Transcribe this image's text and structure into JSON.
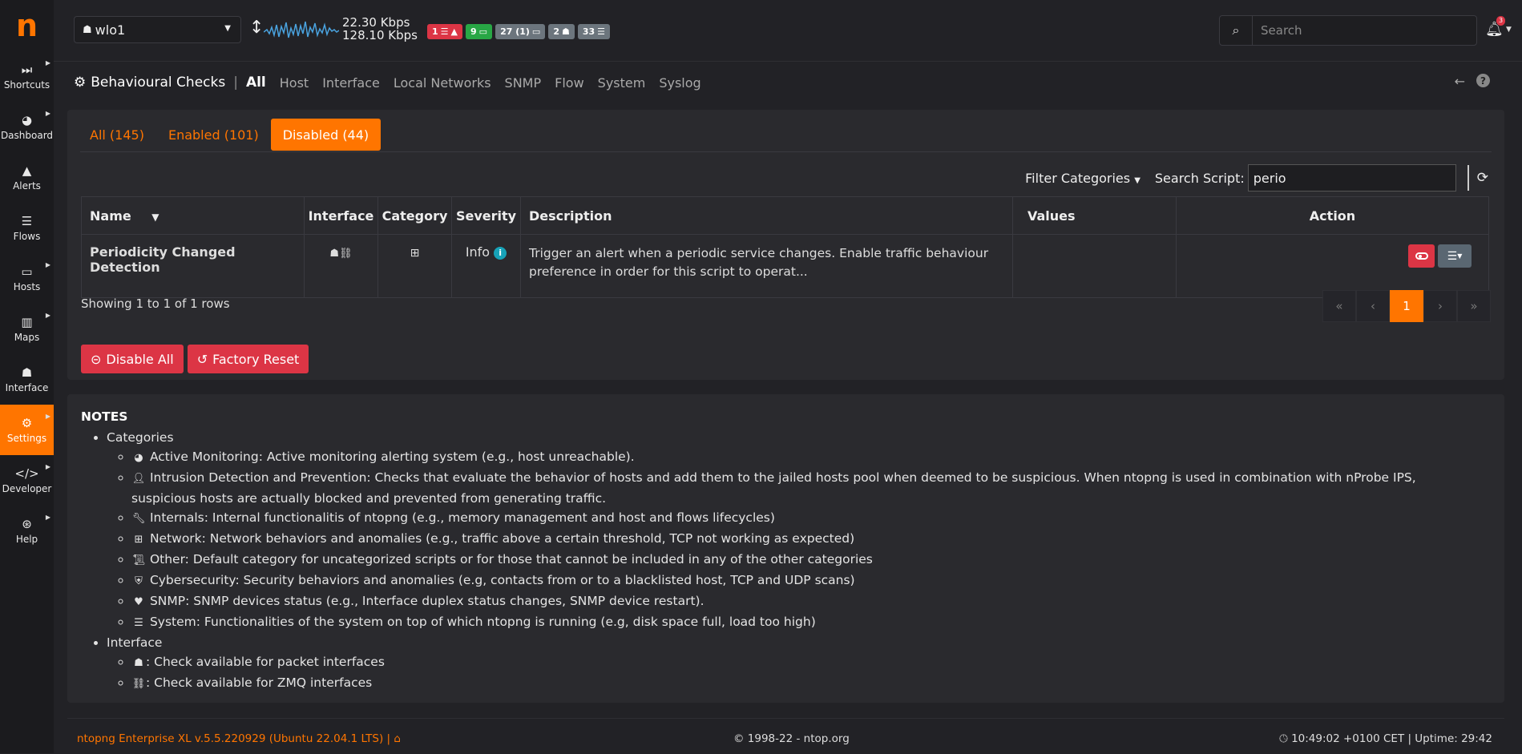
{
  "sidebar": {
    "logo": "n",
    "items": [
      {
        "label": "Shortcuts",
        "icon": "⏭"
      },
      {
        "label": "Dashboard",
        "icon": "◕"
      },
      {
        "label": "Alerts",
        "icon": "▲"
      },
      {
        "label": "Flows",
        "icon": "☰"
      },
      {
        "label": "Hosts",
        "icon": "▭"
      },
      {
        "label": "Maps",
        "icon": "▥"
      },
      {
        "label": "Interface",
        "icon": "☗"
      },
      {
        "label": "Settings",
        "icon": "⚙"
      },
      {
        "label": "Developer",
        "icon": "</>"
      },
      {
        "label": "Help",
        "icon": "⊛"
      }
    ]
  },
  "topbar": {
    "interface": "wlo1",
    "rate_up": "22.30 Kbps",
    "rate_down": "128.10 Kbps",
    "badges": [
      "1",
      "9",
      "27 (1)",
      "2",
      "33"
    ],
    "search_placeholder": "Search",
    "notification_count": "3"
  },
  "page_header": {
    "title": "Behavioural Checks",
    "separator": "|",
    "links": [
      "All",
      "Host",
      "Interface",
      "Local Networks",
      "SNMP",
      "Flow",
      "System",
      "Syslog"
    ],
    "back_icon": "←",
    "help_icon": "?"
  },
  "tabs": [
    "All (145)",
    "Enabled (101)",
    "Disabled (44)"
  ],
  "filter": {
    "categories_label": "Filter Categories",
    "search_label": "Search Script:",
    "search_value": "perio"
  },
  "table": {
    "headers": [
      "Name",
      "Interface",
      "Category",
      "Severity",
      "Description",
      "Values",
      "Action"
    ],
    "sort_indicator": "▼",
    "rows": [
      {
        "name": "Periodicity Changed Detection",
        "severity": "Info",
        "description": "Trigger an alert when a periodic service changes. Enable traffic behaviour preference in order for this script to operat...",
        "values": ""
      }
    ]
  },
  "showing": "Showing 1 to 1 of 1 rows",
  "pagination": [
    "«",
    "‹",
    "1",
    "›",
    "»"
  ],
  "buttons": {
    "disable_all": "Disable All",
    "factory_reset": "Factory Reset"
  },
  "notes": {
    "title": "NOTES",
    "categories_label": "Categories",
    "categories": [
      "Active Monitoring: Active monitoring alerting system (e.g., host unreachable).",
      "Intrusion Detection and Prevention: Checks that evaluate the behavior of hosts and add them to the jailed hosts pool when deemed to be suspicious. When ntopng is used in combination with nProbe IPS, suspicious hosts are actually blocked and prevented from generating traffic.",
      "Internals: Internal functionalitis of ntopng (e.g., memory management and host and flows lifecycles)",
      "Network: Network behaviors and anomalies (e.g., traffic above a certain threshold, TCP not working as expected)",
      "Other: Default category for uncategorized scripts or for those that cannot be included in any of the other categories",
      "Cybersecurity: Security behaviors and anomalies (e.g, contacts from or to a blacklisted host, TCP and UDP scans)",
      "SNMP: SNMP devices status (e.g., Interface duplex status changes, SNMP device restart).",
      "System: Functionalities of the system on top of which ntopng is running (e.g, disk space full, load too high)"
    ],
    "interface_label": "Interface",
    "interface_items": [
      ": Check available for packet interfaces",
      ": Check available for ZMQ interfaces"
    ]
  },
  "footer": {
    "version": "ntopng Enterprise XL v.5.5.220929 (Ubuntu 22.04.1 LTS) |",
    "copyright": "© 1998-22 - ntop.org",
    "status": "10:49:02 +0100 CET | Uptime: 29:42"
  },
  "colors": {
    "accent": "#ff7500",
    "danger": "#dc3545",
    "success": "#28a745",
    "info": "#17a2b8"
  }
}
